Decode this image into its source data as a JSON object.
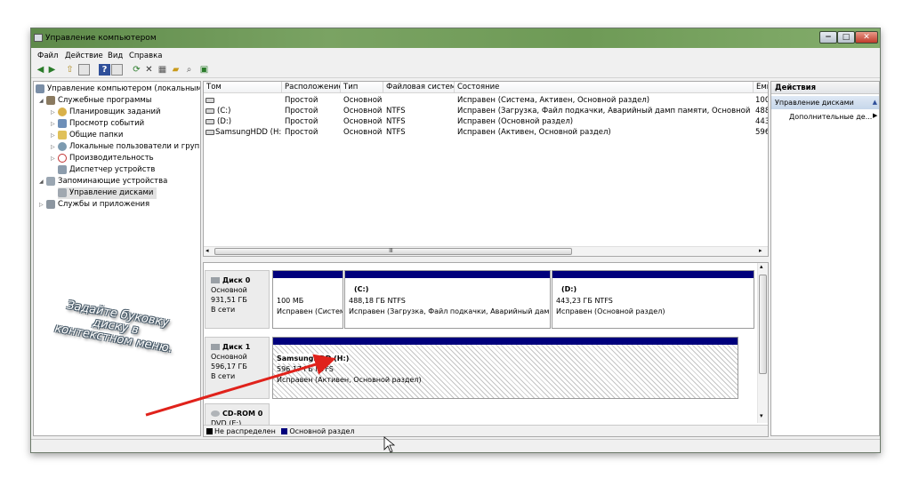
{
  "window": {
    "title": "Управление компьютером",
    "controls": [
      "−",
      "□",
      "✕"
    ]
  },
  "menu": [
    "Файл",
    "Действие",
    "Вид",
    "Справка"
  ],
  "toolbar": [
    "back-icon",
    "forward-icon",
    "up-icon",
    "console-tree-icon",
    "help-icon",
    "help-topics-icon",
    "refresh-icon",
    "delete-icon",
    "properties-icon",
    "open-icon",
    "search-icon",
    "action-icon"
  ],
  "tree": {
    "root": "Управление компьютером (локальным)",
    "service": "Служебные программы",
    "scheduler": "Планировщик заданий",
    "events": "Просмотр событий",
    "shares": "Общие папки",
    "users": "Локальные пользователи и группы",
    "perf": "Производительность",
    "devmgr": "Диспетчер устройств",
    "storage": "Запоминающие устройства",
    "diskmgmt": "Управление дисками",
    "services": "Службы и приложения"
  },
  "volumes": {
    "headers": [
      "Том",
      "Расположение",
      "Тип",
      "Файловая система",
      "Состояние",
      "Емк"
    ],
    "rows": [
      [
        "",
        "Простой",
        "Основной",
        "",
        "Исправен (Система, Активен, Основной раздел)",
        "100"
      ],
      [
        "(C:)",
        "Простой",
        "Основной",
        "NTFS",
        "Исправен (Загрузка, Файл подкачки, Аварийный дамп памяти, Основной раздел)",
        "488"
      ],
      [
        "(D:)",
        "Простой",
        "Основной",
        "NTFS",
        "Исправен (Основной раздел)",
        "443"
      ],
      [
        "SamsungHDD (H:)",
        "Простой",
        "Основной",
        "NTFS",
        "Исправен (Активен, Основной раздел)",
        "596"
      ]
    ],
    "scroll_glyph": "Ⅲ"
  },
  "disks": {
    "disk0": {
      "name": "Диск 0",
      "type": "Основной",
      "size": "931,51 ГБ",
      "state": "В сети",
      "p1": {
        "size": "100 МБ",
        "status": "Исправен (Систем"
      },
      "p2": {
        "name": "(C:)",
        "size": "488,18 ГБ NTFS",
        "status": "Исправен (Загрузка, Файл подкачки, Аварийный дамп п"
      },
      "p3": {
        "name": "(D:)",
        "size": "443,23 ГБ NTFS",
        "status": "Исправен (Основной раздел)"
      }
    },
    "disk1": {
      "name": "Диск 1",
      "type": "Основной",
      "size": "596,17 ГБ",
      "state": "В сети",
      "p1": {
        "name": "SamsungHDD (H:)",
        "size": "596,17 ГБ NTFS",
        "status": "Исправен (Активен, Основной раздел)"
      }
    },
    "cdrom": {
      "name": "CD-ROM 0",
      "type": "DVD (E:)"
    }
  },
  "legend": {
    "unalloc": "Не распределен",
    "primary": "Основной раздел"
  },
  "actions": {
    "header": "Действия",
    "section": "Управление дисками",
    "item": "Дополнительные де..."
  },
  "annotation": "Задайте буковку диску в контекстном меню.",
  "colors": {
    "partition_bar": "#00007c",
    "title_bar": "#6e9a56",
    "arrow": "#e0221b"
  }
}
